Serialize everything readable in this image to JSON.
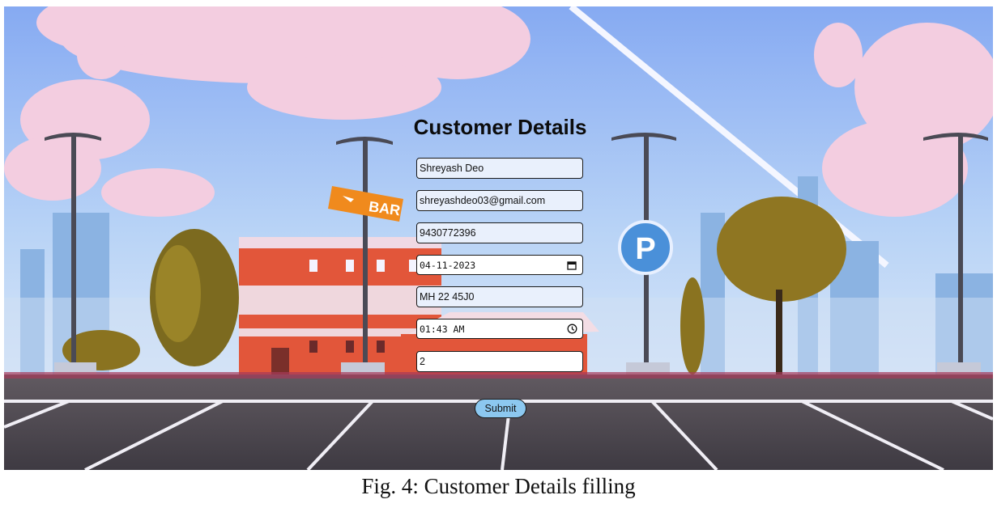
{
  "form": {
    "title": "Customer Details",
    "name_value": "Shreyash Deo",
    "email_value": "shreyashdeo03@gmail.com",
    "phone_value": "9430772396",
    "date_value": "04-11-2023",
    "vehicle_value": "MH 22 45J0",
    "time_value": "01:43 AM",
    "hours_value": "2",
    "submit_label": "Submit"
  },
  "scene": {
    "sign_text": "BAR",
    "parking_sign_text": "P"
  },
  "caption": "Fig. 4: Customer Details filling",
  "icons": {
    "date": "calendar-icon",
    "time": "clock-icon"
  },
  "colors": {
    "submit_bg": "#8cc8f0",
    "field_bg": "#e9f0fc",
    "sky": "#a9c9f2"
  }
}
